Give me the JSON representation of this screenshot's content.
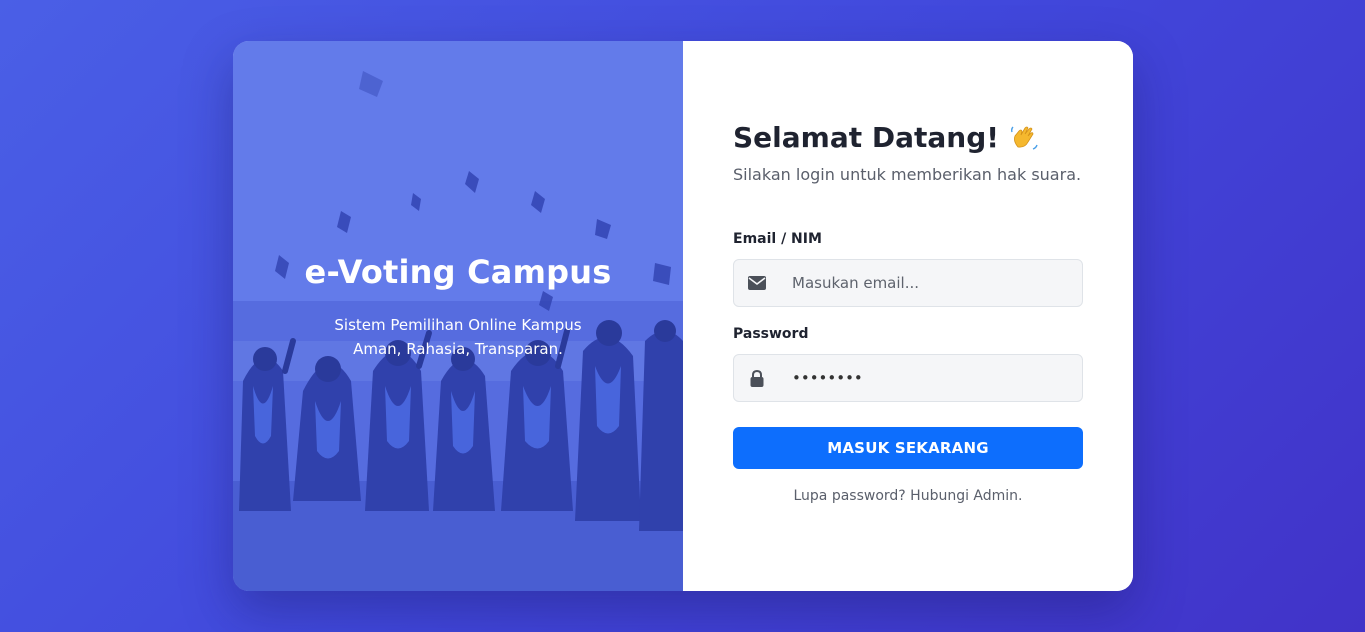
{
  "hero": {
    "title": "e-Voting Campus",
    "subtitle_line1": "Sistem Pemilihan Online Kampus",
    "subtitle_line2": "Aman, Rahasia, Transparan."
  },
  "form": {
    "welcome": "Selamat Datang!",
    "welcome_emoji": "waving-hand-icon",
    "subtitle": "Silakan login untuk memberikan hak suara.",
    "email_label": "Email / NIM",
    "email_placeholder": "Masukan email...",
    "email_icon": "envelope-icon",
    "password_label": "Password",
    "password_value": "password",
    "password_icon": "lock-icon",
    "submit_label": "MASUK SEKARANG",
    "forgot_text": "Lupa password? Hubungi Admin."
  },
  "colors": {
    "background": "#4148dc",
    "primary_button": "#0d6efd",
    "hero_overlay": "#5d76ea"
  }
}
